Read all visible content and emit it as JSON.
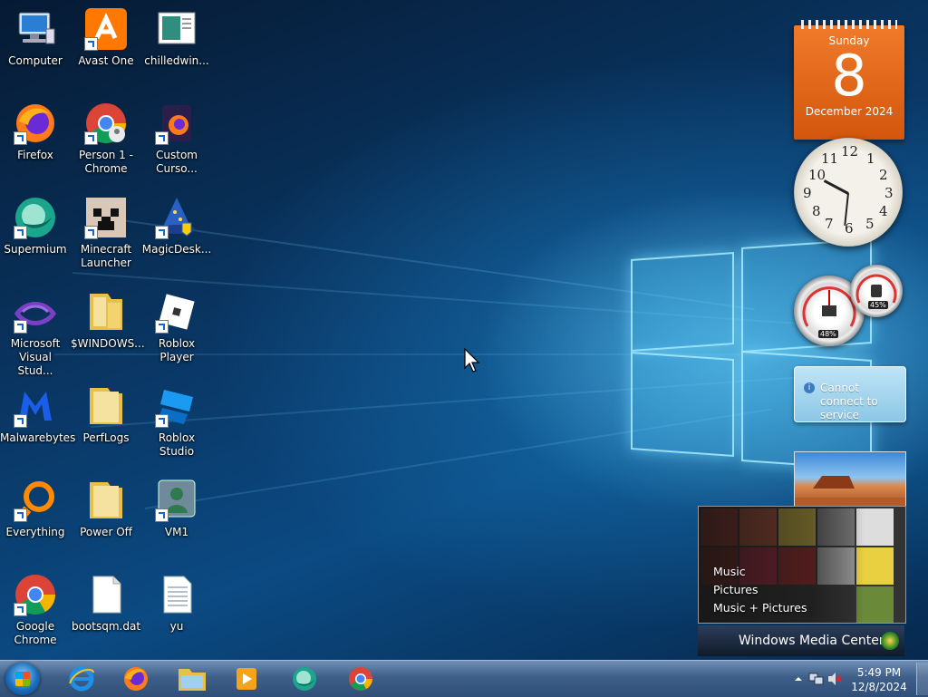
{
  "desktop": {
    "icons": [
      {
        "label": "Computer"
      },
      {
        "label": "Avast One"
      },
      {
        "label": "chilledwin..."
      },
      {
        "label": "Firefox"
      },
      {
        "label": "Person 1 - Chrome"
      },
      {
        "label": "Custom Curso..."
      },
      {
        "label": "Supermium"
      },
      {
        "label": "Minecraft Launcher"
      },
      {
        "label": "MagicDesk..."
      },
      {
        "label": "Microsoft Visual Stud..."
      },
      {
        "label": "$WINDOWS..."
      },
      {
        "label": "Roblox Player"
      },
      {
        "label": "Malwarebytes"
      },
      {
        "label": "PerfLogs"
      },
      {
        "label": "Roblox Studio"
      },
      {
        "label": "Everything"
      },
      {
        "label": "Power Off"
      },
      {
        "label": "VM1"
      },
      {
        "label": "Google Chrome"
      },
      {
        "label": "bootsqm.dat"
      },
      {
        "label": "yu"
      }
    ]
  },
  "gadgets": {
    "calendar": {
      "weekday": "Sunday",
      "day": "8",
      "month_year": "December 2024"
    },
    "clock": {
      "numerals": [
        "12",
        "1",
        "2",
        "3",
        "4",
        "5",
        "6",
        "7",
        "8",
        "9",
        "10",
        "11"
      ]
    },
    "cpu_meter": {
      "cpu_percent": "48%",
      "memory_percent": "45%"
    },
    "notice": {
      "text": "Cannot connect to service"
    },
    "media_center": {
      "menu": [
        "Music",
        "Pictures",
        "Music + Pictures"
      ],
      "title": "Windows Media Center"
    }
  },
  "taskbar": {
    "pinned": [
      {
        "name": "Internet Explorer"
      },
      {
        "name": "Firefox"
      },
      {
        "name": "Windows Explorer"
      },
      {
        "name": "Windows Media Player"
      },
      {
        "name": "Supermium"
      },
      {
        "name": "Google Chrome"
      }
    ],
    "time": "5:49 PM",
    "date": "12/8/2024"
  },
  "colors": {
    "calendar": "#e8691a",
    "taskbar": "#4a6a94",
    "desktop": "#0b3a6a"
  }
}
